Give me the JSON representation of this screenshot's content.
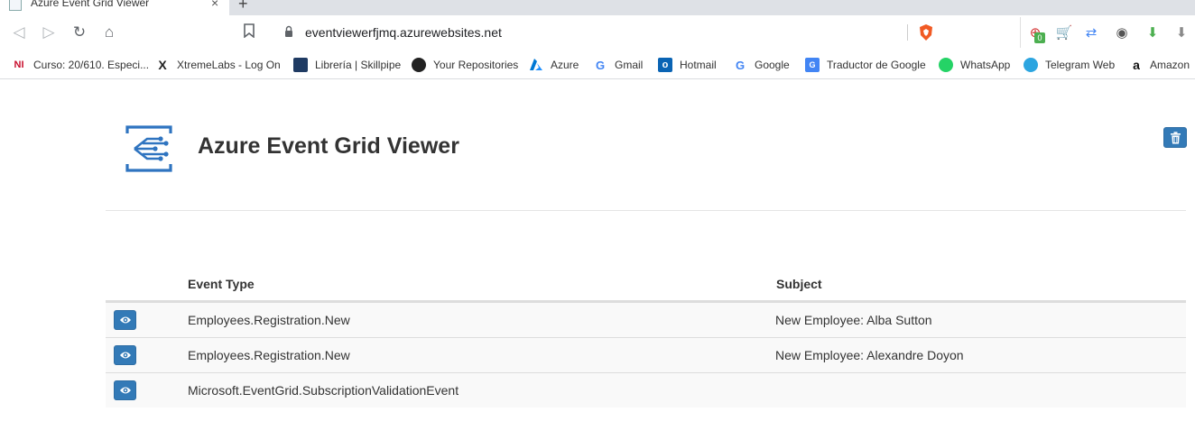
{
  "browser": {
    "tab_title": "Azure Event Grid Viewer",
    "tab_close": "×",
    "new_tab": "+",
    "url": "eventviewerfjmq.azurewebsites.net",
    "extension_badge": "0",
    "bookmarks": [
      {
        "label": "Curso: 20/610. Especi...",
        "icon": "NI"
      },
      {
        "label": "XtremeLabs - Log On",
        "icon": "X"
      },
      {
        "label": "Librería | Skillpipe",
        "icon": "book-icon"
      },
      {
        "label": "Your Repositories",
        "icon": "github-icon"
      },
      {
        "label": "Azure",
        "icon": "azure-icon"
      },
      {
        "label": "Gmail",
        "icon": "G"
      },
      {
        "label": "Hotmail",
        "icon": "outlook-icon"
      },
      {
        "label": "Google",
        "icon": "G"
      },
      {
        "label": "Traductor de Google",
        "icon": "translate-icon"
      },
      {
        "label": "WhatsApp",
        "icon": "whatsapp-icon"
      },
      {
        "label": "Telegram Web",
        "icon": "telegram-icon"
      },
      {
        "label": "Amazon",
        "icon": "a"
      }
    ]
  },
  "header": {
    "title": "Azure Event Grid Viewer"
  },
  "table": {
    "columns": {
      "event_type": "Event Type",
      "subject": "Subject"
    },
    "rows": [
      {
        "event_type": "Employees.Registration.New",
        "subject": "New Employee: Alba Sutton"
      },
      {
        "event_type": "Employees.Registration.New",
        "subject": "New Employee: Alexandre Doyon"
      },
      {
        "event_type": "Microsoft.EventGrid.SubscriptionValidationEvent",
        "subject": ""
      }
    ]
  },
  "colors": {
    "primary_button": "#337ab7",
    "logo_blue": "#2f74c0"
  }
}
